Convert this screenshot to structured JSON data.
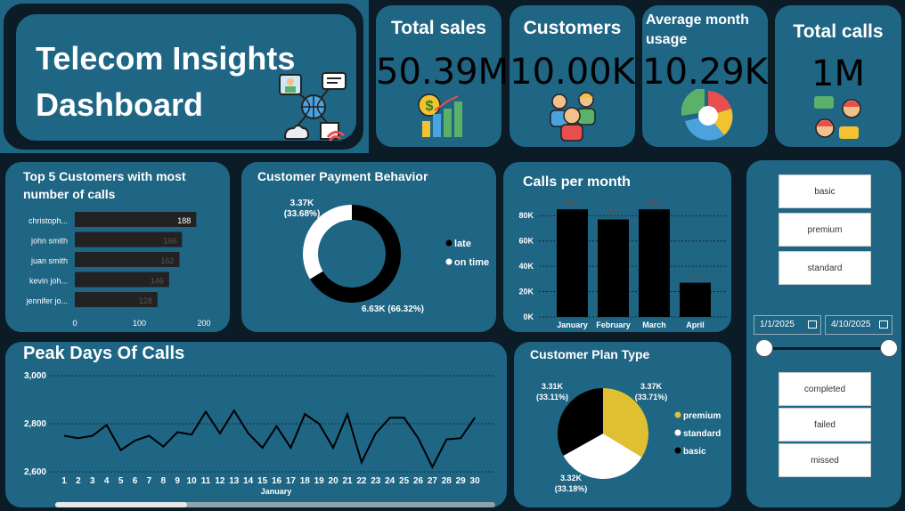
{
  "header": {
    "title_line1": "Telecom Insights",
    "title_line2": "Dashboard"
  },
  "kpis": [
    {
      "label": "Total sales",
      "value": "50.39M"
    },
    {
      "label": "Customers",
      "value": "10.00K"
    },
    {
      "label": "Average month usage",
      "value": "10.29K"
    },
    {
      "label": "Total calls",
      "value": "1M"
    }
  ],
  "top_customers": {
    "title": "Top 5 Customers with most number of calls",
    "names": [
      "christoph...",
      "john smith",
      "juan smith",
      "kevin joh...",
      "jennifer jo..."
    ],
    "values": [
      188,
      166,
      162,
      146,
      128
    ],
    "labels": [
      "188",
      "166",
      "162",
      "146",
      "128"
    ],
    "ticks": [
      "0",
      "100",
      "200"
    ],
    "max": 200
  },
  "payment": {
    "title": "Customer Payment Behavior",
    "late_label": "6.63K (66.32%)",
    "ontime_label1": "3.37K",
    "ontime_label2": "(33.68%)",
    "late_share": 0.6632,
    "legend": [
      "late",
      "on time"
    ]
  },
  "calls_month": {
    "title": "Calls per month",
    "categories": [
      "January",
      "February",
      "March",
      "April"
    ],
    "values": [
      85000,
      77000,
      85000,
      27000
    ],
    "labels": [
      "85K",
      "77K",
      "85K",
      "27K"
    ],
    "ticks": [
      "0K",
      "20K",
      "40K",
      "60K",
      "80K"
    ],
    "max": 90000
  },
  "peak_days": {
    "title": "Peak Days Of Calls",
    "xlabel": "January",
    "y_ticks": [
      "3,000",
      "2,800",
      "2,600"
    ],
    "days": [
      "1",
      "2",
      "3",
      "4",
      "5",
      "6",
      "7",
      "8",
      "9",
      "10",
      "11",
      "12",
      "13",
      "14",
      "15",
      "16",
      "17",
      "18",
      "19",
      "20",
      "21",
      "22",
      "23",
      "24",
      "25",
      "26",
      "27",
      "28",
      "29",
      "30"
    ],
    "values": [
      2750,
      2740,
      2750,
      2795,
      2690,
      2730,
      2750,
      2705,
      2765,
      2755,
      2850,
      2760,
      2855,
      2760,
      2700,
      2790,
      2700,
      2840,
      2800,
      2700,
      2840,
      2640,
      2760,
      2825,
      2825,
      2740,
      2620,
      2735,
      2740,
      2825
    ],
    "ymin": 2600,
    "ymax": 3000
  },
  "plan_type": {
    "title": "Customer Plan Type",
    "shares": [
      0.3371,
      0.3318,
      0.3311
    ],
    "legend": [
      "premium",
      "standard",
      "basic"
    ],
    "label_premium": [
      "3.37K",
      "(33.71%)"
    ],
    "label_standard": [
      "3.32K",
      "(33.18%)"
    ],
    "label_basic": [
      "3.31K",
      "(33.11%)"
    ]
  },
  "filters": {
    "plans": [
      "basic",
      "premium",
      "standard"
    ],
    "date_start": "1/1/2025",
    "date_end": "4/10/2025",
    "statuses": [
      "completed",
      "failed",
      "missed"
    ]
  },
  "chart_data": [
    {
      "type": "bar",
      "title": "Top 5 Customers with most number of calls",
      "categories": [
        "christoph...",
        "john smith",
        "juan smith",
        "kevin joh...",
        "jennifer jo..."
      ],
      "values": [
        188,
        166,
        162,
        146,
        128
      ],
      "xlim": [
        0,
        200
      ]
    },
    {
      "type": "pie",
      "title": "Customer Payment Behavior",
      "categories": [
        "late",
        "on time"
      ],
      "values": [
        6630,
        3370
      ]
    },
    {
      "type": "bar",
      "title": "Calls per month",
      "categories": [
        "January",
        "February",
        "March",
        "April"
      ],
      "values": [
        85000,
        77000,
        85000,
        27000
      ],
      "ylim": [
        0,
        90000
      ]
    },
    {
      "type": "line",
      "title": "Peak Days Of Calls",
      "xlabel": "January",
      "x": [
        1,
        2,
        3,
        4,
        5,
        6,
        7,
        8,
        9,
        10,
        11,
        12,
        13,
        14,
        15,
        16,
        17,
        18,
        19,
        20,
        21,
        22,
        23,
        24,
        25,
        26,
        27,
        28,
        29,
        30
      ],
      "values": [
        2750,
        2740,
        2750,
        2795,
        2690,
        2730,
        2750,
        2705,
        2765,
        2755,
        2850,
        2760,
        2855,
        2760,
        2700,
        2790,
        2700,
        2840,
        2800,
        2700,
        2840,
        2640,
        2760,
        2825,
        2825,
        2740,
        2620,
        2735,
        2740,
        2825
      ],
      "ylim": [
        2600,
        3000
      ]
    },
    {
      "type": "pie",
      "title": "Customer Plan Type",
      "categories": [
        "premium",
        "standard",
        "basic"
      ],
      "values": [
        3370,
        3320,
        3310
      ]
    }
  ],
  "colors": {
    "bg": "#1f6584",
    "dark": "#0b1c26",
    "accent_yellow": "#e0c030"
  }
}
